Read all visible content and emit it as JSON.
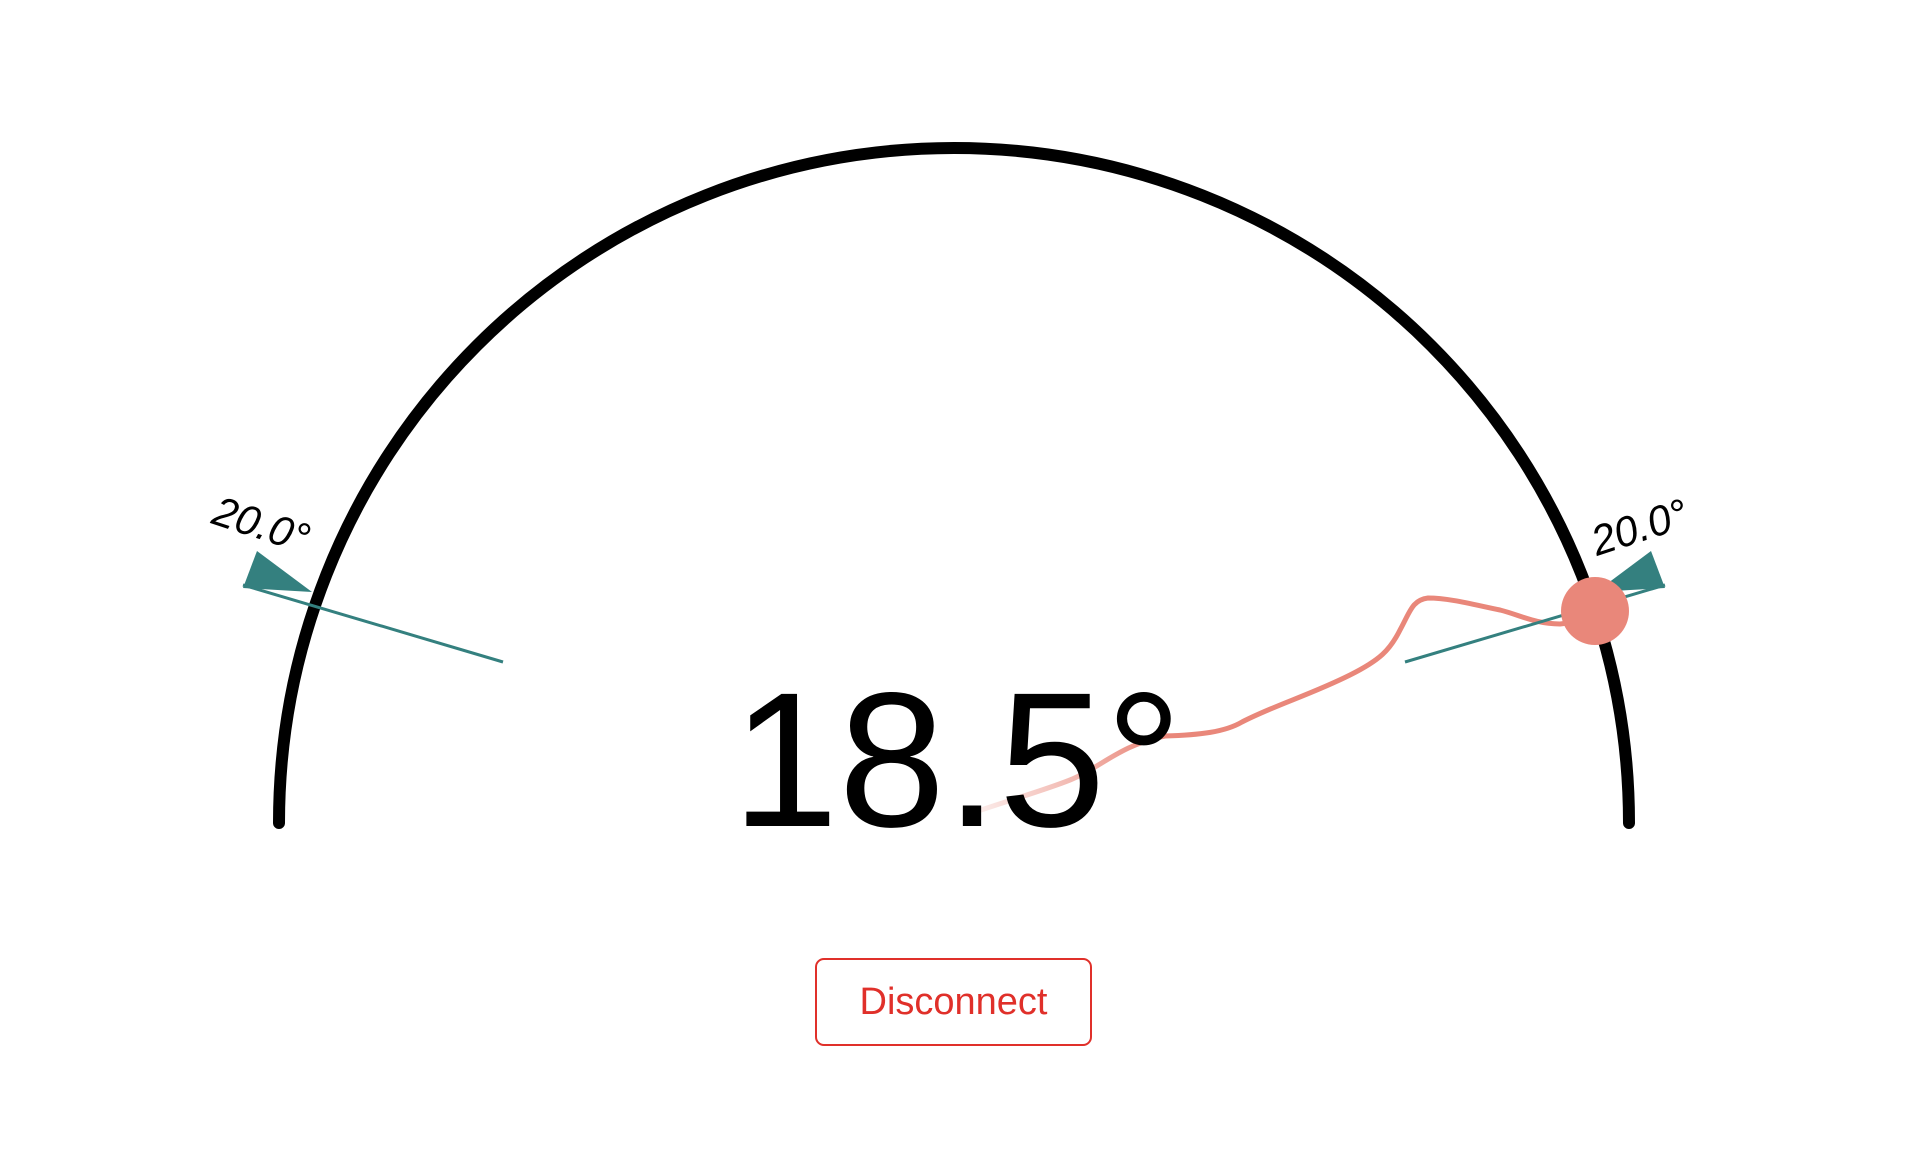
{
  "gauge": {
    "current_angle_label": "18.5°",
    "left_marker_label": "20.0°",
    "right_marker_label": "20.0°",
    "colors": {
      "arc": "#000000",
      "marker": "#34807f",
      "trace": "#e9877a",
      "indicator_dot": "#e9877a"
    }
  },
  "controls": {
    "disconnect_label": "Disconnect",
    "disconnect_color": "#e0302a"
  }
}
